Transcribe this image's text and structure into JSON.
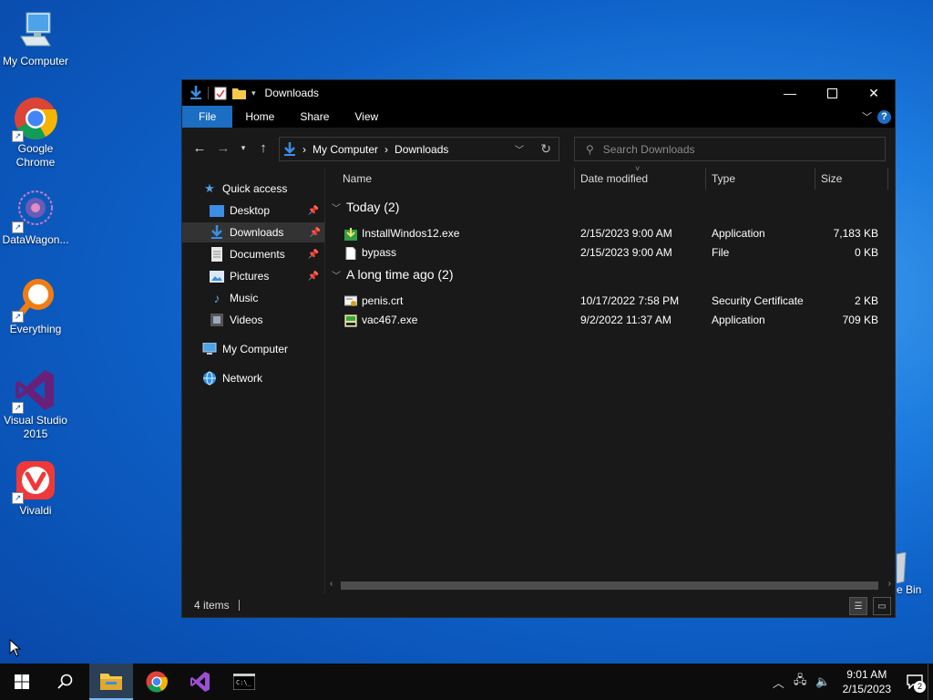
{
  "desktop": {
    "icons": [
      {
        "label": "My Computer"
      },
      {
        "label": "Google Chrome"
      },
      {
        "label": "DataWagon..."
      },
      {
        "label": "Everything"
      },
      {
        "label": "Visual Studio 2015"
      },
      {
        "label": "Vivaldi"
      }
    ],
    "recycle_bin_partial_label": "e Bin"
  },
  "explorer": {
    "title": "Downloads",
    "ribbon_tabs": [
      "File",
      "Home",
      "Share",
      "View"
    ],
    "address": {
      "crumbs": [
        "My Computer",
        "Downloads"
      ]
    },
    "search_placeholder": "Search Downloads",
    "nav": {
      "quick_access": "Quick access",
      "items": [
        {
          "label": "Desktop",
          "pinned": true
        },
        {
          "label": "Downloads",
          "pinned": true,
          "selected": true
        },
        {
          "label": "Documents",
          "pinned": true
        },
        {
          "label": "Pictures",
          "pinned": true
        },
        {
          "label": "Music"
        },
        {
          "label": "Videos"
        }
      ],
      "my_computer": "My Computer",
      "network": "Network"
    },
    "columns": {
      "name": "Name",
      "date": "Date modified",
      "type": "Type",
      "size": "Size"
    },
    "groups": [
      {
        "title": "Today (2)",
        "files": [
          {
            "name": "InstallWindos12.exe",
            "date": "2/15/2023 9:00 AM",
            "type": "Application",
            "size": "7,183 KB",
            "icon": "installer-icon"
          },
          {
            "name": "bypass",
            "date": "2/15/2023 9:00 AM",
            "type": "File",
            "size": "0 KB",
            "icon": "blank-file-icon"
          }
        ]
      },
      {
        "title": "A long time ago (2)",
        "files": [
          {
            "name": "penis.crt",
            "date": "10/17/2022 7:58 PM",
            "type": "Security Certificate",
            "size": "2 KB",
            "icon": "certificate-icon"
          },
          {
            "name": "vac467.exe",
            "date": "9/2/2022 11:37 AM",
            "type": "Application",
            "size": "709 KB",
            "icon": "exe-icon"
          }
        ]
      }
    ],
    "status": {
      "item_count": "4 items"
    }
  },
  "taskbar": {
    "time": "9:01 AM",
    "date": "2/15/2023",
    "notification_count": "2"
  },
  "colors": {
    "accent": "#1b6ec2",
    "window_bg": "#191919",
    "taskbar_bg": "#0c0c0c"
  }
}
